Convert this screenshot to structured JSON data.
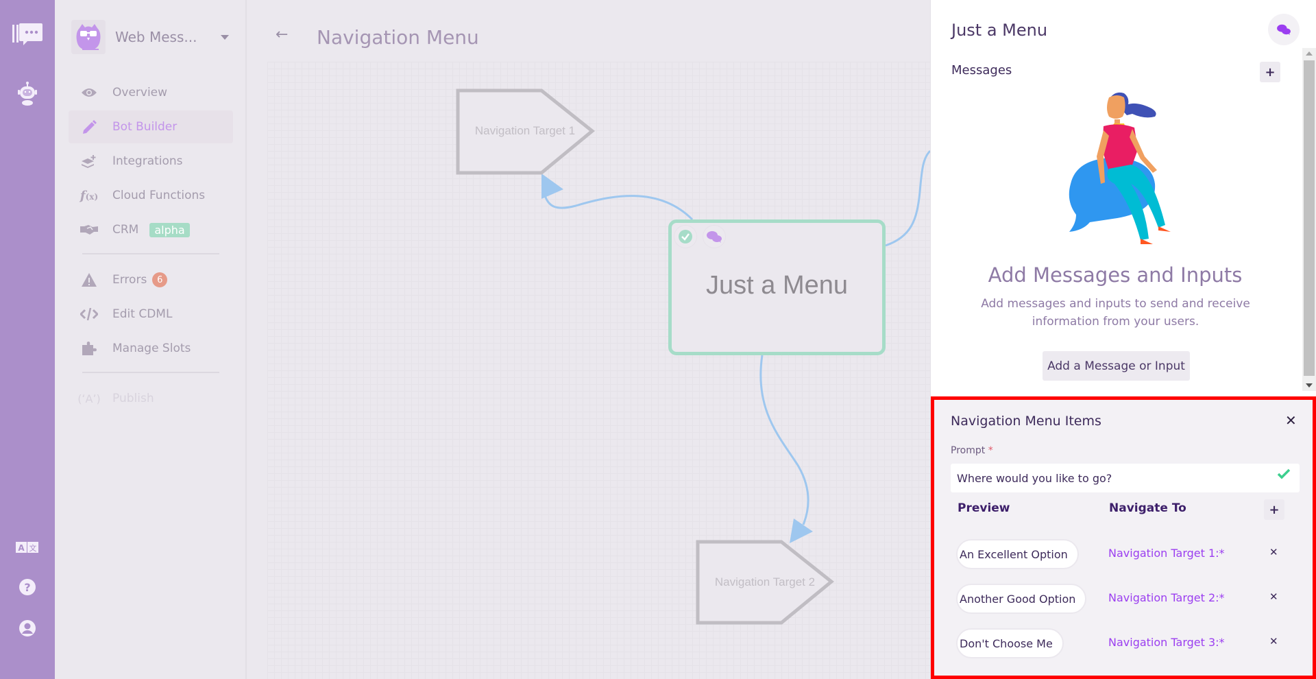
{
  "rail": {
    "top_icons": [
      "chat-logo-icon",
      "robot-icon"
    ],
    "bottom_icons": [
      "translate-icon",
      "help-icon",
      "user-account-icon"
    ]
  },
  "sidebar": {
    "bot_name": "Web Mess...",
    "items": [
      {
        "label": "Overview",
        "icon": "eye-icon",
        "active": false
      },
      {
        "label": "Bot Builder",
        "icon": "pencil-icon",
        "active": true
      },
      {
        "label": "Integrations",
        "icon": "layers-plus-icon",
        "active": false
      },
      {
        "label": "Cloud Functions",
        "icon": "function-icon",
        "active": false
      },
      {
        "label": "CRM",
        "icon": "handshake-icon",
        "badge": "alpha",
        "active": false
      },
      {
        "label": "Errors",
        "icon": "warning-icon",
        "count": "6",
        "active": false
      },
      {
        "label": "Edit CDML",
        "icon": "code-icon",
        "active": false
      },
      {
        "label": "Manage Slots",
        "icon": "puzzle-icon",
        "active": false
      },
      {
        "label": "Publish",
        "icon": "broadcast-icon",
        "disabled": true
      }
    ]
  },
  "canvas": {
    "back_label": "←",
    "title": "Navigation Menu",
    "nodes": {
      "main": "Just a Menu",
      "target1": "Navigation Target 1",
      "target2": "Navigation Target 2"
    },
    "colors": {
      "edge": "#9ec7ef",
      "main_border": "#a6dcc8",
      "target_border": "#c0bdc3"
    }
  },
  "panel": {
    "title": "Just a Menu",
    "messages_label": "Messages",
    "add_plus": "+",
    "empty_title": "Add Messages and Inputs",
    "empty_desc": "Add messages and inputs to send and receive information from your users.",
    "add_button": "Add a Message or Input"
  },
  "nav_items": {
    "title": "Navigation Menu Items",
    "close": "✕",
    "prompt_label": "Prompt",
    "required_mark": "*",
    "prompt_value": "Where would you like to go?",
    "col_preview": "Preview",
    "col_navigate": "Navigate To",
    "add_plus": "+",
    "rows": [
      {
        "preview": "An Excellent Option",
        "target": "Navigation Target 1:*",
        "delete": "✕"
      },
      {
        "preview": "Another Good Option",
        "target": "Navigation Target 2:*",
        "delete": "✕"
      },
      {
        "preview": "Don't Choose Me",
        "target": "Navigation Target 3:*",
        "delete": "✕"
      }
    ],
    "highlight_color": "#ff0000"
  }
}
